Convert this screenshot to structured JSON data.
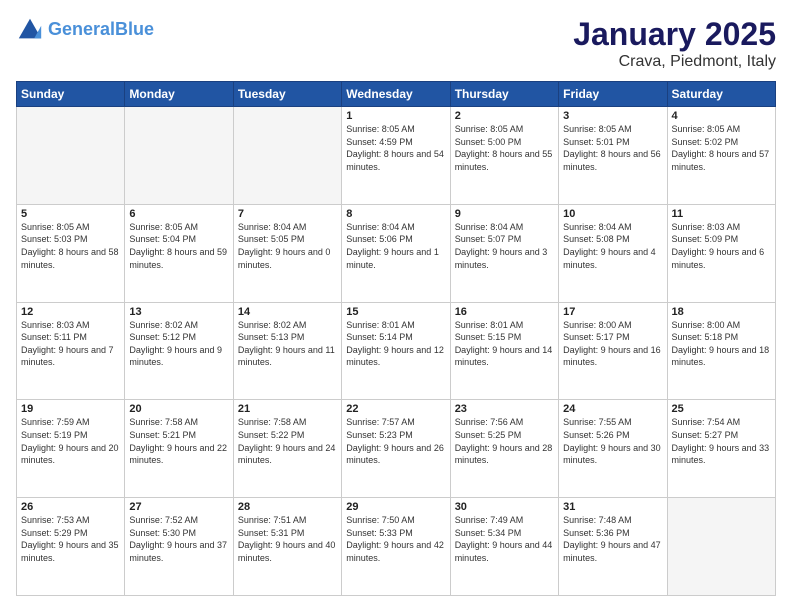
{
  "header": {
    "logo_line1": "General",
    "logo_line2": "Blue",
    "main_title": "January 2025",
    "subtitle": "Crava, Piedmont, Italy"
  },
  "days_of_week": [
    "Sunday",
    "Monday",
    "Tuesday",
    "Wednesday",
    "Thursday",
    "Friday",
    "Saturday"
  ],
  "weeks": [
    [
      {
        "day": "",
        "detail": ""
      },
      {
        "day": "",
        "detail": ""
      },
      {
        "day": "",
        "detail": ""
      },
      {
        "day": "1",
        "detail": "Sunrise: 8:05 AM\nSunset: 4:59 PM\nDaylight: 8 hours\nand 54 minutes."
      },
      {
        "day": "2",
        "detail": "Sunrise: 8:05 AM\nSunset: 5:00 PM\nDaylight: 8 hours\nand 55 minutes."
      },
      {
        "day": "3",
        "detail": "Sunrise: 8:05 AM\nSunset: 5:01 PM\nDaylight: 8 hours\nand 56 minutes."
      },
      {
        "day": "4",
        "detail": "Sunrise: 8:05 AM\nSunset: 5:02 PM\nDaylight: 8 hours\nand 57 minutes."
      }
    ],
    [
      {
        "day": "5",
        "detail": "Sunrise: 8:05 AM\nSunset: 5:03 PM\nDaylight: 8 hours\nand 58 minutes."
      },
      {
        "day": "6",
        "detail": "Sunrise: 8:05 AM\nSunset: 5:04 PM\nDaylight: 8 hours\nand 59 minutes."
      },
      {
        "day": "7",
        "detail": "Sunrise: 8:04 AM\nSunset: 5:05 PM\nDaylight: 9 hours\nand 0 minutes."
      },
      {
        "day": "8",
        "detail": "Sunrise: 8:04 AM\nSunset: 5:06 PM\nDaylight: 9 hours\nand 1 minute."
      },
      {
        "day": "9",
        "detail": "Sunrise: 8:04 AM\nSunset: 5:07 PM\nDaylight: 9 hours\nand 3 minutes."
      },
      {
        "day": "10",
        "detail": "Sunrise: 8:04 AM\nSunset: 5:08 PM\nDaylight: 9 hours\nand 4 minutes."
      },
      {
        "day": "11",
        "detail": "Sunrise: 8:03 AM\nSunset: 5:09 PM\nDaylight: 9 hours\nand 6 minutes."
      }
    ],
    [
      {
        "day": "12",
        "detail": "Sunrise: 8:03 AM\nSunset: 5:11 PM\nDaylight: 9 hours\nand 7 minutes."
      },
      {
        "day": "13",
        "detail": "Sunrise: 8:02 AM\nSunset: 5:12 PM\nDaylight: 9 hours\nand 9 minutes."
      },
      {
        "day": "14",
        "detail": "Sunrise: 8:02 AM\nSunset: 5:13 PM\nDaylight: 9 hours\nand 11 minutes."
      },
      {
        "day": "15",
        "detail": "Sunrise: 8:01 AM\nSunset: 5:14 PM\nDaylight: 9 hours\nand 12 minutes."
      },
      {
        "day": "16",
        "detail": "Sunrise: 8:01 AM\nSunset: 5:15 PM\nDaylight: 9 hours\nand 14 minutes."
      },
      {
        "day": "17",
        "detail": "Sunrise: 8:00 AM\nSunset: 5:17 PM\nDaylight: 9 hours\nand 16 minutes."
      },
      {
        "day": "18",
        "detail": "Sunrise: 8:00 AM\nSunset: 5:18 PM\nDaylight: 9 hours\nand 18 minutes."
      }
    ],
    [
      {
        "day": "19",
        "detail": "Sunrise: 7:59 AM\nSunset: 5:19 PM\nDaylight: 9 hours\nand 20 minutes."
      },
      {
        "day": "20",
        "detail": "Sunrise: 7:58 AM\nSunset: 5:21 PM\nDaylight: 9 hours\nand 22 minutes."
      },
      {
        "day": "21",
        "detail": "Sunrise: 7:58 AM\nSunset: 5:22 PM\nDaylight: 9 hours\nand 24 minutes."
      },
      {
        "day": "22",
        "detail": "Sunrise: 7:57 AM\nSunset: 5:23 PM\nDaylight: 9 hours\nand 26 minutes."
      },
      {
        "day": "23",
        "detail": "Sunrise: 7:56 AM\nSunset: 5:25 PM\nDaylight: 9 hours\nand 28 minutes."
      },
      {
        "day": "24",
        "detail": "Sunrise: 7:55 AM\nSunset: 5:26 PM\nDaylight: 9 hours\nand 30 minutes."
      },
      {
        "day": "25",
        "detail": "Sunrise: 7:54 AM\nSunset: 5:27 PM\nDaylight: 9 hours\nand 33 minutes."
      }
    ],
    [
      {
        "day": "26",
        "detail": "Sunrise: 7:53 AM\nSunset: 5:29 PM\nDaylight: 9 hours\nand 35 minutes."
      },
      {
        "day": "27",
        "detail": "Sunrise: 7:52 AM\nSunset: 5:30 PM\nDaylight: 9 hours\nand 37 minutes."
      },
      {
        "day": "28",
        "detail": "Sunrise: 7:51 AM\nSunset: 5:31 PM\nDaylight: 9 hours\nand 40 minutes."
      },
      {
        "day": "29",
        "detail": "Sunrise: 7:50 AM\nSunset: 5:33 PM\nDaylight: 9 hours\nand 42 minutes."
      },
      {
        "day": "30",
        "detail": "Sunrise: 7:49 AM\nSunset: 5:34 PM\nDaylight: 9 hours\nand 44 minutes."
      },
      {
        "day": "31",
        "detail": "Sunrise: 7:48 AM\nSunset: 5:36 PM\nDaylight: 9 hours\nand 47 minutes."
      },
      {
        "day": "",
        "detail": ""
      }
    ]
  ]
}
